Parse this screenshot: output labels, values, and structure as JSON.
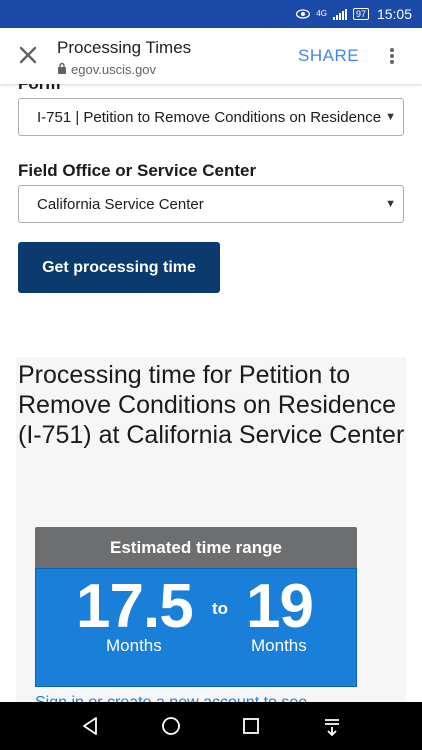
{
  "status_bar": {
    "network": "4G",
    "battery": "97",
    "time": "15:05"
  },
  "toolbar": {
    "title": "Processing Times",
    "url": "egov.uscis.gov",
    "share_label": "SHARE"
  },
  "form": {
    "form_label": "Form",
    "form_value": "I-751 | Petition to Remove Conditions on Residence",
    "office_label": "Field Office or Service Center",
    "office_value": "California Service Center",
    "submit_label": "Get processing time"
  },
  "result": {
    "title": "Processing time for Petition to Remove Conditions on Residence (I-751) at California Service Center",
    "range_header": "Estimated time range",
    "from_value": "17.5",
    "from_unit": "Months",
    "to_word": "to",
    "to_value": "19",
    "to_unit": "Months",
    "link_partial": "Sign in or create a new account to see"
  },
  "colors": {
    "status_bar": "#1c4aa8",
    "share": "#4285f4",
    "button": "#0b3a6e",
    "range_header": "#6d6e6f",
    "range_body": "#1a7fd9"
  },
  "icons": [
    "eye-icon",
    "signal-icon",
    "battery-icon",
    "close-icon",
    "lock-icon",
    "more-vert-icon",
    "dropdown-arrow-icon",
    "back-icon",
    "home-icon",
    "recents-icon",
    "notifications-icon"
  ]
}
